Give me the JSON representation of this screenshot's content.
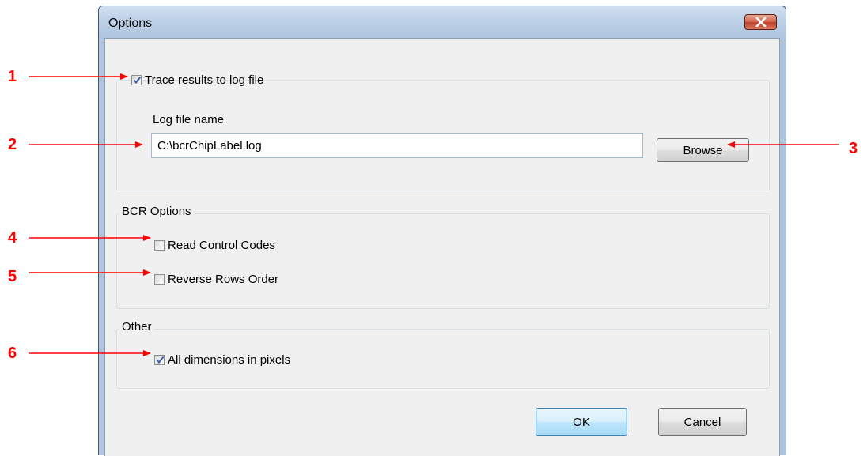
{
  "window": {
    "title": "Options",
    "close_icon": "close-icon"
  },
  "logging": {
    "trace_label": "Trace results to log file",
    "trace_checked": true,
    "log_file_label": "Log file name",
    "log_file_value": "C:\\bcrChipLabel.log",
    "browse_label": "Browse"
  },
  "bcr_options": {
    "group_label": "BCR Options",
    "read_control_codes_label": "Read Control Codes",
    "read_control_codes_checked": false,
    "reverse_rows_label": "Reverse Rows Order",
    "reverse_rows_checked": false
  },
  "other": {
    "group_label": "Other",
    "pixels_label": "All dimensions in pixels",
    "pixels_checked": true
  },
  "buttons": {
    "ok_label": "OK",
    "cancel_label": "Cancel"
  },
  "callouts": [
    "1",
    "2",
    "3",
    "4",
    "5",
    "6"
  ],
  "colors": {
    "callout": "#ff0000",
    "checkmark": "#3b5fa8",
    "close_button": "#c7462d"
  }
}
